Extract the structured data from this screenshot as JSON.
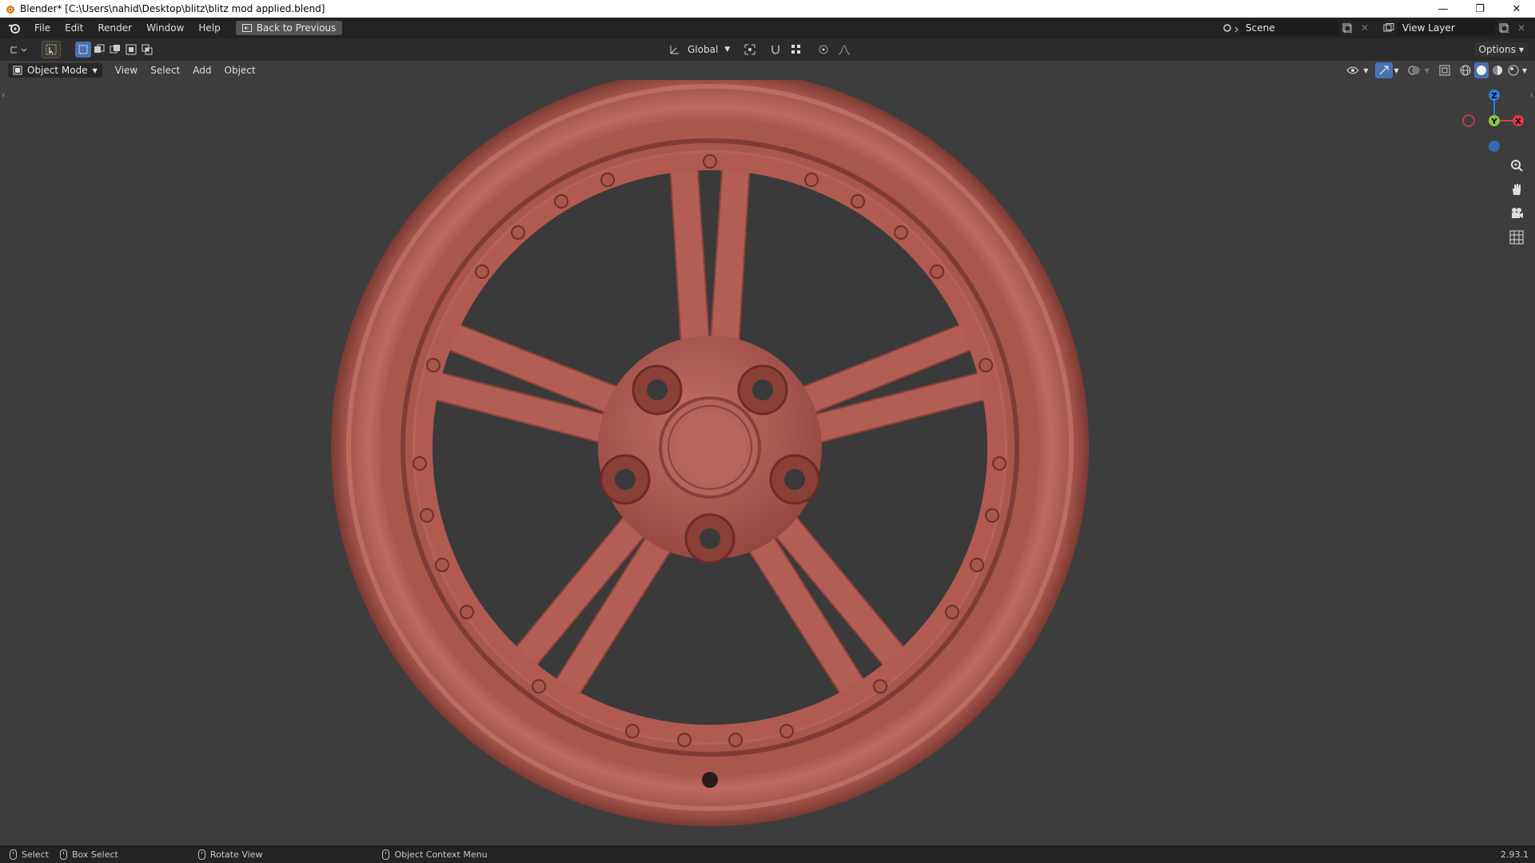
{
  "window": {
    "title": "Blender* [C:\\Users\\nahid\\Desktop\\blitz\\blitz mod applied.blend]",
    "controls": [
      "minimize-icon",
      "restore-icon",
      "close-icon"
    ]
  },
  "topbar": {
    "menus": [
      "File",
      "Edit",
      "Render",
      "Window",
      "Help"
    ],
    "back_button": "Back to Previous",
    "scene": "Scene",
    "view_layer": "View Layer"
  },
  "toolbar": {
    "orientation": "Global",
    "options_label": "Options"
  },
  "viewport_header": {
    "mode": "Object Mode",
    "menus": [
      "View",
      "Select",
      "Add",
      "Object"
    ]
  },
  "gizmo": {
    "x": "X",
    "y": "Y",
    "z": "Z"
  },
  "statusbar": {
    "select": "Select",
    "box_select": "Box Select",
    "rotate_view": "Rotate View",
    "context_menu": "Object Context Menu",
    "version": "2.93.1"
  },
  "colors": {
    "wheel": "#b05a50",
    "background": "#3d3d3d",
    "axis_x": "#e0394e",
    "axis_y": "#8cc63f",
    "axis_z": "#2f7de1"
  }
}
